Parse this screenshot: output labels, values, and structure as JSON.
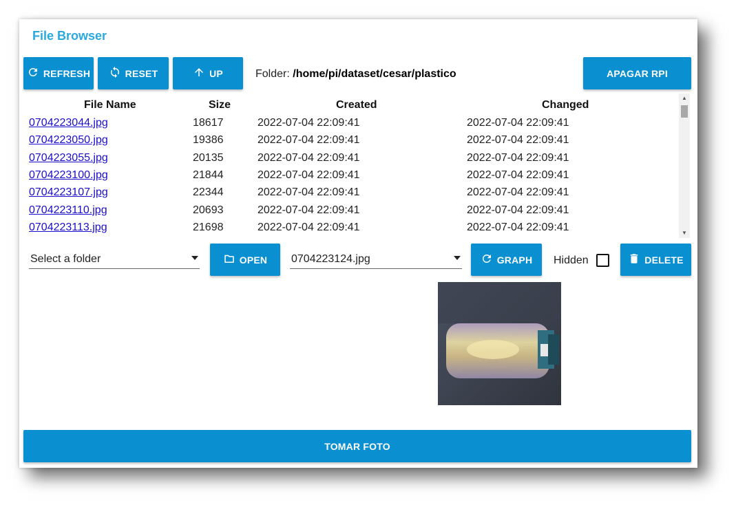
{
  "app": {
    "title": "File Browser"
  },
  "toolbar": {
    "refresh_label": "REFRESH",
    "reset_label": "RESET",
    "up_label": "UP",
    "apagar_label": "APAGAR RPI"
  },
  "folder": {
    "prefix": "Folder:",
    "path": "/home/pi/dataset/cesar/plastico"
  },
  "table": {
    "headers": {
      "name": "File Name",
      "size": "Size",
      "created": "Created",
      "changed": "Changed"
    },
    "rows": [
      {
        "name": "0704223044.jpg",
        "size": "18617",
        "created": "2022-07-04 22:09:41",
        "changed": "2022-07-04 22:09:41"
      },
      {
        "name": "0704223050.jpg",
        "size": "19386",
        "created": "2022-07-04 22:09:41",
        "changed": "2022-07-04 22:09:41"
      },
      {
        "name": "0704223055.jpg",
        "size": "20135",
        "created": "2022-07-04 22:09:41",
        "changed": "2022-07-04 22:09:41"
      },
      {
        "name": "0704223100.jpg",
        "size": "21844",
        "created": "2022-07-04 22:09:41",
        "changed": "2022-07-04 22:09:41"
      },
      {
        "name": "0704223107.jpg",
        "size": "22344",
        "created": "2022-07-04 22:09:41",
        "changed": "2022-07-04 22:09:41"
      },
      {
        "name": "0704223110.jpg",
        "size": "20693",
        "created": "2022-07-04 22:09:41",
        "changed": "2022-07-04 22:09:41"
      },
      {
        "name": "0704223113.jpg",
        "size": "21698",
        "created": "2022-07-04 22:09:41",
        "changed": "2022-07-04 22:09:41"
      }
    ]
  },
  "controls": {
    "folder_select_placeholder": "Select a folder",
    "open_label": "OPEN",
    "file_select_value": "0704223124.jpg",
    "graph_label": "GRAPH",
    "hidden_label": "Hidden",
    "hidden_checked": false,
    "delete_label": "DELETE"
  },
  "footer": {
    "capture_label": "TOMAR FOTO"
  },
  "colors": {
    "accent": "#0a8fd0",
    "title": "#29a9e0",
    "link": "#1a0dcc"
  },
  "icons": {
    "refresh": "refresh-icon",
    "reset": "sync-icon",
    "up": "arrow-up-icon",
    "open": "folder-icon",
    "graph": "refresh-icon",
    "delete": "trash-icon"
  }
}
